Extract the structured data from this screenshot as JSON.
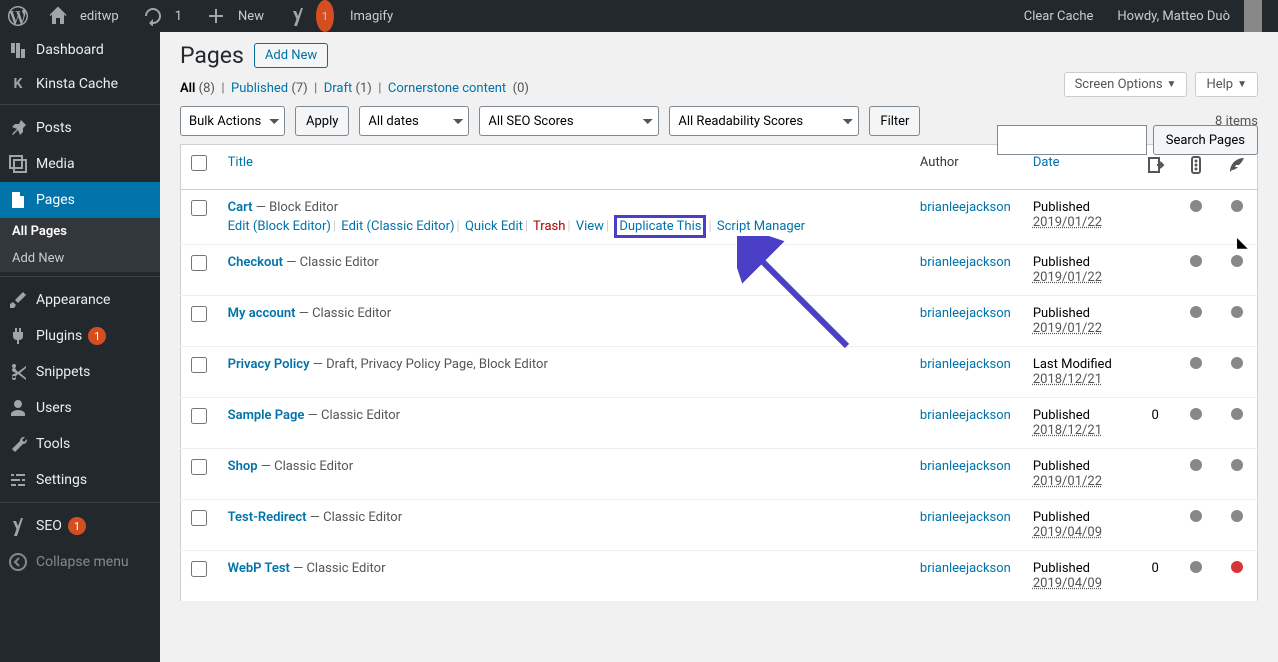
{
  "adminbar": {
    "site": "editwp",
    "updates": "1",
    "new": "New",
    "imagify": "Imagify",
    "yoast_badge": "1",
    "clear_cache": "Clear Cache",
    "howdy": "Howdy, Matteo Duò"
  },
  "sidebar": {
    "dashboard": "Dashboard",
    "kinsta": "Kinsta Cache",
    "posts": "Posts",
    "media": "Media",
    "pages": "Pages",
    "all_pages": "All Pages",
    "add_new": "Add New",
    "appearance": "Appearance",
    "plugins": "Plugins",
    "plugins_count": "1",
    "snippets": "Snippets",
    "users": "Users",
    "tools": "Tools",
    "settings": "Settings",
    "seo": "SEO",
    "seo_count": "1",
    "collapse": "Collapse menu"
  },
  "top_actions": {
    "screen": "Screen Options",
    "help": "Help"
  },
  "heading": "Pages",
  "add_new_btn": "Add New",
  "views": {
    "all": "All",
    "all_count": "(8)",
    "published": "Published",
    "published_count": "(7)",
    "draft": "Draft",
    "draft_count": "(1)",
    "corner": "Cornerstone content",
    "corner_count": "(0)"
  },
  "search_btn": "Search Pages",
  "bulk": {
    "actions": "Bulk Actions",
    "apply": "Apply",
    "dates": "All dates",
    "seo": "All SEO Scores",
    "read": "All Readability Scores",
    "filter": "Filter",
    "items": "8 items"
  },
  "cols": {
    "title": "Title",
    "author": "Author",
    "date": "Date"
  },
  "rowactions": {
    "edit_block": "Edit (Block Editor)",
    "edit_classic": "Edit (Classic Editor)",
    "quick": "Quick Edit",
    "trash": "Trash",
    "view": "View",
    "dup": "Duplicate This",
    "script": "Script Manager"
  },
  "rows": [
    {
      "title": "Cart",
      "state": " — Block Editor",
      "author": "brianleejackson",
      "date_label": "Published",
      "date": "2019/01/22",
      "comments": "",
      "seo": "gray",
      "read": "gray",
      "show_actions": true
    },
    {
      "title": "Checkout",
      "state": " — Classic Editor",
      "author": "brianleejackson",
      "date_label": "Published",
      "date": "2019/01/22",
      "comments": "",
      "seo": "gray",
      "read": "gray"
    },
    {
      "title": "My account",
      "state": " — Classic Editor",
      "author": "brianleejackson",
      "date_label": "Published",
      "date": "2019/01/22",
      "comments": "",
      "seo": "gray",
      "read": "gray"
    },
    {
      "title": "Privacy Policy",
      "state": " — Draft, Privacy Policy Page, Block Editor",
      "author": "brianleejackson",
      "date_label": "Last Modified",
      "date": "2018/12/21",
      "comments": "",
      "seo": "gray",
      "read": "gray"
    },
    {
      "title": "Sample Page",
      "state": " — Classic Editor",
      "author": "brianleejackson",
      "date_label": "Published",
      "date": "2018/12/21",
      "comments": "0",
      "seo": "gray",
      "read": "gray"
    },
    {
      "title": "Shop",
      "state": " — Classic Editor",
      "author": "brianleejackson",
      "date_label": "Published",
      "date": "2019/01/22",
      "comments": "",
      "seo": "gray",
      "read": "gray"
    },
    {
      "title": "Test-Redirect",
      "state": " — Classic Editor",
      "author": "brianleejackson",
      "date_label": "Published",
      "date": "2019/04/09",
      "comments": "",
      "seo": "gray",
      "read": "gray"
    },
    {
      "title": "WebP Test",
      "state": " — Classic Editor",
      "author": "brianleejackson",
      "date_label": "Published",
      "date": "2019/04/09",
      "comments": "0",
      "seo": "gray",
      "read": "red"
    }
  ]
}
